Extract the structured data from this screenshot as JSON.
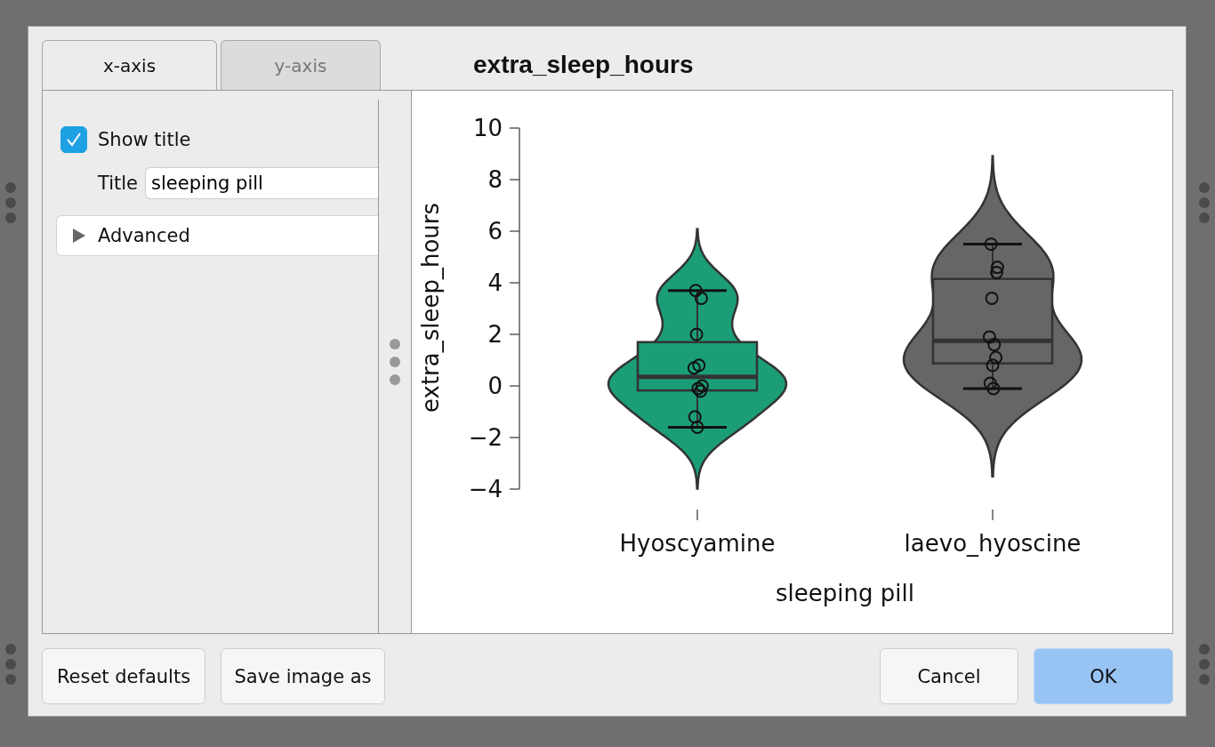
{
  "dialog": {
    "title": "extra_sleep_hours",
    "tabs": [
      {
        "label": "x-axis",
        "selected": true
      },
      {
        "label": "y-axis",
        "selected": false
      }
    ],
    "options": {
      "show_title": {
        "label": "Show title",
        "checked": true
      },
      "title_field": {
        "label": "Title",
        "value": "sleeping pill"
      },
      "advanced": {
        "label": "Advanced",
        "expanded": false
      }
    },
    "plot": {
      "chart_data": {
        "type": "scatter",
        "xlabel": "sleeping pill",
        "ylabel": "extra_sleep_hours",
        "categories": [
          "Hyoscyamine",
          "laevo_hyoscine"
        ],
        "ylim": [
          -4,
          10
        ],
        "yticks": [
          {
            "value": -4,
            "label": "−4"
          },
          {
            "value": -2,
            "label": "−2"
          },
          {
            "value": 0,
            "label": "0"
          },
          {
            "value": 2,
            "label": "2"
          },
          {
            "value": 4,
            "label": "4"
          },
          {
            "value": 6,
            "label": "6"
          },
          {
            "value": 8,
            "label": "8"
          },
          {
            "value": 10,
            "label": "10"
          }
        ],
        "series": [
          {
            "values": [
              0.7,
              1.9
            ]
          },
          {
            "values": [
              -1.6,
              0.8
            ]
          },
          {
            "values": [
              -0.2,
              1.1
            ]
          },
          {
            "values": [
              -1.2,
              0.1
            ]
          },
          {
            "values": [
              -0.1,
              -0.1
            ]
          },
          {
            "values": [
              3.4,
              4.4
            ]
          },
          {
            "values": [
              3.7,
              5.5
            ]
          },
          {
            "values": [
              0.8,
              1.6
            ]
          },
          {
            "values": [
              0.0,
              4.6
            ]
          },
          {
            "values": [
              2.0,
              3.4
            ]
          }
        ]
      },
      "violins": [
        {
          "color": "#1b9e77"
        },
        {
          "color": "#666666"
        }
      ]
    },
    "buttons_left": [
      {
        "label": "Reset defaults",
        "primary": false
      },
      {
        "label": "Save image as",
        "primary": false
      }
    ],
    "buttons_right": [
      {
        "label": "Cancel",
        "primary": false
      },
      {
        "label": "OK",
        "primary": true
      }
    ]
  }
}
